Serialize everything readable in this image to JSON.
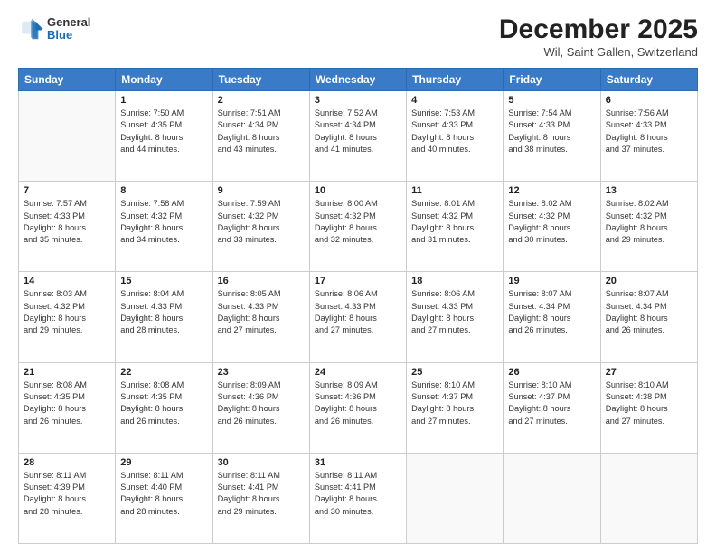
{
  "header": {
    "logo": {
      "general": "General",
      "blue": "Blue"
    },
    "title": "December 2025",
    "location": "Wil, Saint Gallen, Switzerland"
  },
  "days_of_week": [
    "Sunday",
    "Monday",
    "Tuesday",
    "Wednesday",
    "Thursday",
    "Friday",
    "Saturday"
  ],
  "weeks": [
    [
      {
        "day": "",
        "info": ""
      },
      {
        "day": "1",
        "info": "Sunrise: 7:50 AM\nSunset: 4:35 PM\nDaylight: 8 hours\nand 44 minutes."
      },
      {
        "day": "2",
        "info": "Sunrise: 7:51 AM\nSunset: 4:34 PM\nDaylight: 8 hours\nand 43 minutes."
      },
      {
        "day": "3",
        "info": "Sunrise: 7:52 AM\nSunset: 4:34 PM\nDaylight: 8 hours\nand 41 minutes."
      },
      {
        "day": "4",
        "info": "Sunrise: 7:53 AM\nSunset: 4:33 PM\nDaylight: 8 hours\nand 40 minutes."
      },
      {
        "day": "5",
        "info": "Sunrise: 7:54 AM\nSunset: 4:33 PM\nDaylight: 8 hours\nand 38 minutes."
      },
      {
        "day": "6",
        "info": "Sunrise: 7:56 AM\nSunset: 4:33 PM\nDaylight: 8 hours\nand 37 minutes."
      }
    ],
    [
      {
        "day": "7",
        "info": "Sunrise: 7:57 AM\nSunset: 4:33 PM\nDaylight: 8 hours\nand 35 minutes."
      },
      {
        "day": "8",
        "info": "Sunrise: 7:58 AM\nSunset: 4:32 PM\nDaylight: 8 hours\nand 34 minutes."
      },
      {
        "day": "9",
        "info": "Sunrise: 7:59 AM\nSunset: 4:32 PM\nDaylight: 8 hours\nand 33 minutes."
      },
      {
        "day": "10",
        "info": "Sunrise: 8:00 AM\nSunset: 4:32 PM\nDaylight: 8 hours\nand 32 minutes."
      },
      {
        "day": "11",
        "info": "Sunrise: 8:01 AM\nSunset: 4:32 PM\nDaylight: 8 hours\nand 31 minutes."
      },
      {
        "day": "12",
        "info": "Sunrise: 8:02 AM\nSunset: 4:32 PM\nDaylight: 8 hours\nand 30 minutes."
      },
      {
        "day": "13",
        "info": "Sunrise: 8:02 AM\nSunset: 4:32 PM\nDaylight: 8 hours\nand 29 minutes."
      }
    ],
    [
      {
        "day": "14",
        "info": "Sunrise: 8:03 AM\nSunset: 4:32 PM\nDaylight: 8 hours\nand 29 minutes."
      },
      {
        "day": "15",
        "info": "Sunrise: 8:04 AM\nSunset: 4:33 PM\nDaylight: 8 hours\nand 28 minutes."
      },
      {
        "day": "16",
        "info": "Sunrise: 8:05 AM\nSunset: 4:33 PM\nDaylight: 8 hours\nand 27 minutes."
      },
      {
        "day": "17",
        "info": "Sunrise: 8:06 AM\nSunset: 4:33 PM\nDaylight: 8 hours\nand 27 minutes."
      },
      {
        "day": "18",
        "info": "Sunrise: 8:06 AM\nSunset: 4:33 PM\nDaylight: 8 hours\nand 27 minutes."
      },
      {
        "day": "19",
        "info": "Sunrise: 8:07 AM\nSunset: 4:34 PM\nDaylight: 8 hours\nand 26 minutes."
      },
      {
        "day": "20",
        "info": "Sunrise: 8:07 AM\nSunset: 4:34 PM\nDaylight: 8 hours\nand 26 minutes."
      }
    ],
    [
      {
        "day": "21",
        "info": "Sunrise: 8:08 AM\nSunset: 4:35 PM\nDaylight: 8 hours\nand 26 minutes."
      },
      {
        "day": "22",
        "info": "Sunrise: 8:08 AM\nSunset: 4:35 PM\nDaylight: 8 hours\nand 26 minutes."
      },
      {
        "day": "23",
        "info": "Sunrise: 8:09 AM\nSunset: 4:36 PM\nDaylight: 8 hours\nand 26 minutes."
      },
      {
        "day": "24",
        "info": "Sunrise: 8:09 AM\nSunset: 4:36 PM\nDaylight: 8 hours\nand 26 minutes."
      },
      {
        "day": "25",
        "info": "Sunrise: 8:10 AM\nSunset: 4:37 PM\nDaylight: 8 hours\nand 27 minutes."
      },
      {
        "day": "26",
        "info": "Sunrise: 8:10 AM\nSunset: 4:37 PM\nDaylight: 8 hours\nand 27 minutes."
      },
      {
        "day": "27",
        "info": "Sunrise: 8:10 AM\nSunset: 4:38 PM\nDaylight: 8 hours\nand 27 minutes."
      }
    ],
    [
      {
        "day": "28",
        "info": "Sunrise: 8:11 AM\nSunset: 4:39 PM\nDaylight: 8 hours\nand 28 minutes."
      },
      {
        "day": "29",
        "info": "Sunrise: 8:11 AM\nSunset: 4:40 PM\nDaylight: 8 hours\nand 28 minutes."
      },
      {
        "day": "30",
        "info": "Sunrise: 8:11 AM\nSunset: 4:41 PM\nDaylight: 8 hours\nand 29 minutes."
      },
      {
        "day": "31",
        "info": "Sunrise: 8:11 AM\nSunset: 4:41 PM\nDaylight: 8 hours\nand 30 minutes."
      },
      {
        "day": "",
        "info": ""
      },
      {
        "day": "",
        "info": ""
      },
      {
        "day": "",
        "info": ""
      }
    ]
  ]
}
